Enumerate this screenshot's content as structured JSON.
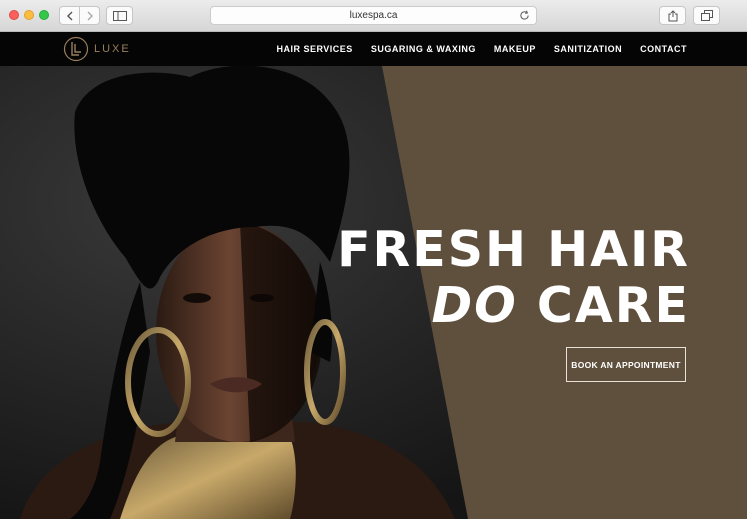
{
  "browser": {
    "url": "luxespa.ca",
    "icons": [
      "back-icon",
      "forward-icon",
      "sidebar-icon",
      "reload-icon",
      "share-icon",
      "tabs-icon"
    ]
  },
  "site": {
    "logo_text": "LUXE",
    "nav": [
      {
        "label": "HAIR SERVICES"
      },
      {
        "label": "SUGARING & WAXING"
      },
      {
        "label": "MAKEUP"
      },
      {
        "label": "SANITIZATION"
      },
      {
        "label": "CONTACT"
      }
    ],
    "hero": {
      "line1": "FRESH HAIR",
      "line2_italic": "DO",
      "line2_rest": "CARE",
      "cta_label": "BOOK AN APPOINTMENT"
    },
    "colors": {
      "accent_brown": "#5f4f3d",
      "logo_gold": "#9a7f5b",
      "nav_bg": "#050505"
    }
  }
}
